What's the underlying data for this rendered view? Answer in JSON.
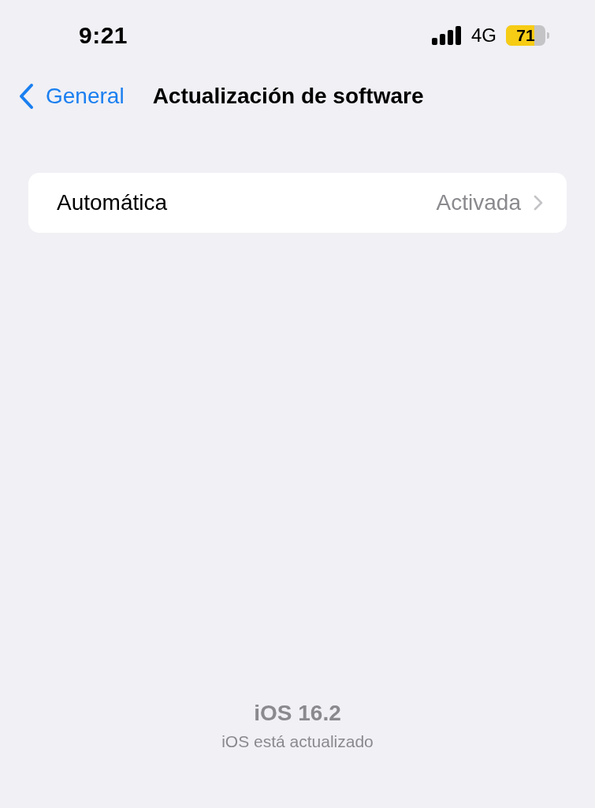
{
  "status_bar": {
    "time": "9:21",
    "network": "4G",
    "battery": "71"
  },
  "nav": {
    "back_label": "General",
    "title": "Actualización de software"
  },
  "settings": [
    {
      "label": "Automática",
      "value": "Activada"
    }
  ],
  "footer": {
    "version": "iOS 16.2",
    "status": "iOS está actualizado"
  }
}
